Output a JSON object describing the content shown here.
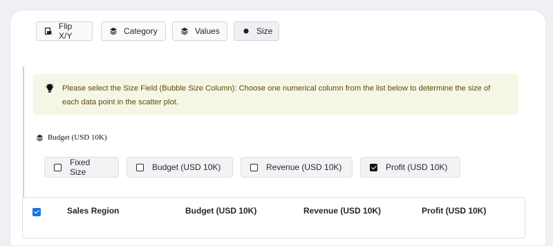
{
  "toolbar": {
    "flip": "Flip X/Y",
    "category": "Category",
    "values": "Values",
    "size": "Size"
  },
  "notice": {
    "text": "Please select the Size Field (Bubble Size Column): Choose one numerical column from the list below to determine the size of each data point in the scatter plot."
  },
  "selected_field": "Budget (USD 10K)",
  "size_options": [
    {
      "label": "Fixed Size",
      "checked": false
    },
    {
      "label": "Budget (USD 10K)",
      "checked": false
    },
    {
      "label": "Revenue (USD 10K)",
      "checked": false
    },
    {
      "label": "Profit (USD 10K)",
      "checked": true
    }
  ],
  "table": {
    "columns": [
      "Sales Region",
      "Budget (USD 10K)",
      "Revenue (USD 10K)",
      "Profit (USD 10K)"
    ]
  },
  "colors": {
    "accent": "#1a73e8",
    "notice_bg": "#f6f6e6",
    "notice_text": "#5b4b05"
  }
}
